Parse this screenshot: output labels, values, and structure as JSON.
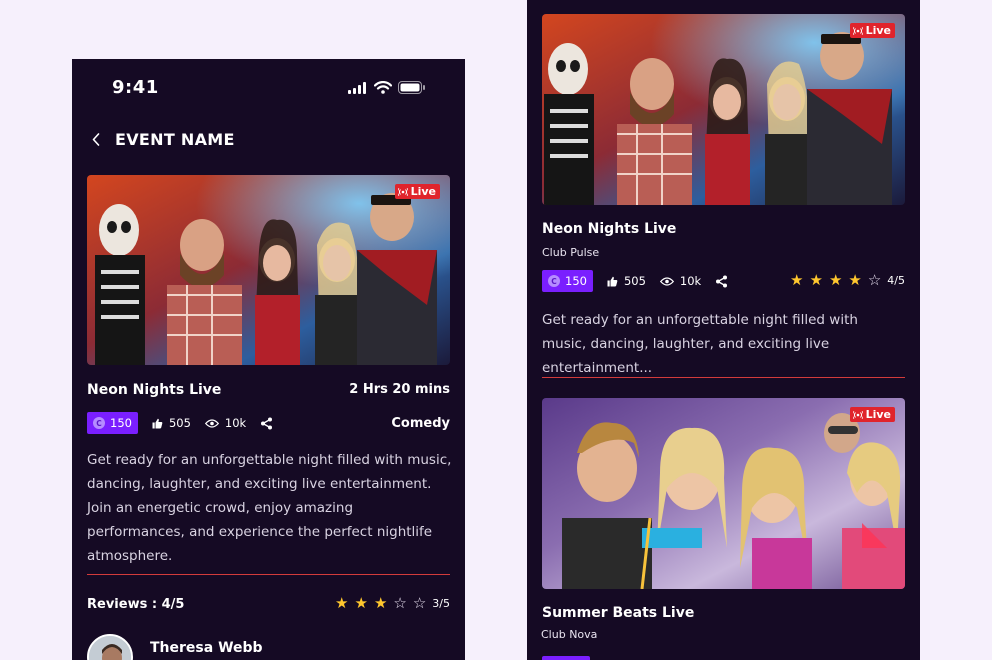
{
  "status_bar": {
    "time": "9:41"
  },
  "header": {
    "title": "EVENT NAME"
  },
  "event": {
    "title": "Neon Nights Live",
    "duration": "2 Hrs 20 mins",
    "live_label": "Live",
    "coins": "150",
    "likes": "505",
    "views": "10k",
    "category": "Comedy",
    "description": "Get ready for an unforgettable night filled with music, dancing, laughter, and exciting live entertainment. Join an energetic crowd, enjoy amazing performances, and experience the perfect nightlife atmosphere."
  },
  "reviews": {
    "label": "Reviews : 4/5",
    "rating_text": "3/5",
    "stars_filled": 3,
    "stars_total": 5,
    "first_reviewer": "Theresa Webb"
  },
  "list": [
    {
      "title": "Neon Nights Live",
      "venue": "Club Pulse",
      "live_label": "Live",
      "coins": "150",
      "likes": "505",
      "views": "10k",
      "rating_text": "4/5",
      "stars_filled": 4,
      "description": "Get ready for an unforgettable night filled with music, dancing, laughter, and exciting live entertainment..."
    },
    {
      "title": "Summer Beats Live",
      "venue": "Club Nova",
      "live_label": "Live"
    }
  ],
  "colors": {
    "background": "#f6f0fc",
    "phone": "#150a24",
    "accent": "#7a1fff",
    "live": "#e0242c",
    "star": "#ffc72e",
    "divider": "#d33b3b"
  },
  "icons": [
    "signal-icon",
    "wifi-icon",
    "battery-icon",
    "back-arrow-icon",
    "broadcast-icon",
    "coin-icon",
    "thumbs-up-icon",
    "eye-icon",
    "share-icon",
    "star-icon"
  ]
}
